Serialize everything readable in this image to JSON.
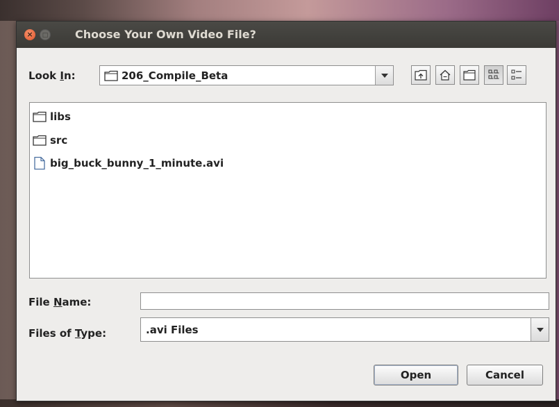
{
  "window": {
    "title": "Choose Your Own Video File?",
    "close_glyph": "×",
    "minimize_glyph": "□"
  },
  "look_in": {
    "label_prefix": "Look ",
    "label_mnemonic": "I",
    "label_suffix": "n:",
    "value": "206_Compile_Beta"
  },
  "toolbar": {
    "icons": [
      "up-folder-icon",
      "home-icon",
      "new-folder-icon",
      "list-view-icon",
      "details-view-icon"
    ],
    "active_view": "list-view"
  },
  "files": [
    {
      "name": "libs",
      "kind": "folder"
    },
    {
      "name": "src",
      "kind": "folder"
    },
    {
      "name": "big_buck_bunny_1_minute.avi",
      "kind": "file"
    }
  ],
  "file_name": {
    "label_prefix": "File ",
    "label_mnemonic": "N",
    "label_suffix": "ame:",
    "value": ""
  },
  "file_type": {
    "label_prefix": "Files of ",
    "label_mnemonic": "T",
    "label_suffix": "ype:",
    "value": ".avi Files"
  },
  "buttons": {
    "open": "Open",
    "cancel": "Cancel"
  },
  "colors": {
    "close_button": "#e0552b",
    "titlebar": "#3b3a36",
    "dialog_bg": "#eeedeb"
  }
}
